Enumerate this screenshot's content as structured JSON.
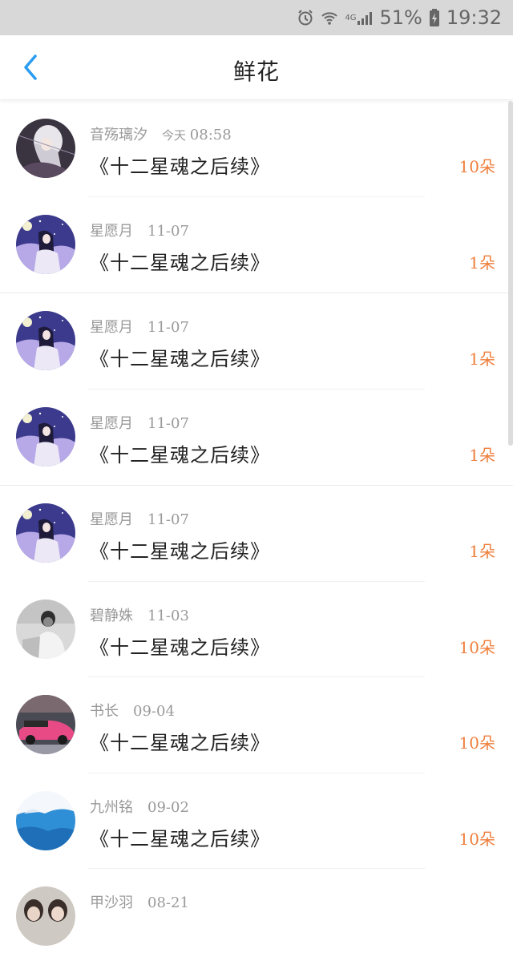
{
  "status_bar": {
    "network": "4G",
    "battery": "51%",
    "time": "19:32"
  },
  "header": {
    "title": "鲜花"
  },
  "gifts": [
    {
      "user": "音殇璃汐",
      "time_prefix": "今天",
      "time": "08:58",
      "book": "《十二星魂之后续》",
      "count": "10朵",
      "avatar": "anime-white-hair"
    },
    {
      "user": "星愿月",
      "time": "11-07",
      "book": "《十二星魂之后续》",
      "count": "1朵",
      "avatar": "anime-purple-night"
    },
    {
      "user": "星愿月",
      "time": "11-07",
      "book": "《十二星魂之后续》",
      "count": "1朵",
      "avatar": "anime-purple-night"
    },
    {
      "user": "星愿月",
      "time": "11-07",
      "book": "《十二星魂之后续》",
      "count": "1朵",
      "avatar": "anime-purple-night"
    },
    {
      "user": "星愿月",
      "time": "11-07",
      "book": "《十二星魂之后续》",
      "count": "1朵",
      "avatar": "anime-purple-night"
    },
    {
      "user": "碧静姝",
      "time": "11-03",
      "book": "《十二星魂之后续》",
      "count": "10朵",
      "avatar": "grayscale-person"
    },
    {
      "user": "书长",
      "time": "09-04",
      "book": "《十二星魂之后续》",
      "count": "10朵",
      "avatar": "pink-sports-car"
    },
    {
      "user": "九州铭",
      "time": "09-02",
      "book": "《十二星魂之后续》",
      "count": "10朵",
      "avatar": "blue-sky"
    },
    {
      "user": "甲沙羽",
      "time": "08-21",
      "book": "",
      "count": "",
      "avatar": "people-photo"
    }
  ],
  "colors": {
    "accent_blue": "#2a9cf2",
    "count_orange": "#ef7e3c"
  }
}
